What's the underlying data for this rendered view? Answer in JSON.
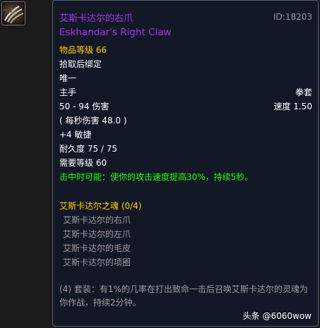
{
  "item": {
    "icon": "claw-icon",
    "id_label": "ID:18203",
    "name_cn": "艾斯卡达尔的右爪",
    "name_en": "Eskhandar's Right Claw",
    "item_level": "物品等级 66",
    "bind": "拾取后绑定",
    "unique": "唯一",
    "slot": "主手",
    "type": "拳套",
    "damage": "50 - 94 伤害",
    "speed": "速度 1.50",
    "dps": "( 每秒伤害 48.0 )",
    "stat": "+4 敏捷",
    "durability": "耐久度 75 / 75",
    "required_level": "需要等级 60",
    "chance_on_hit": "击中时可能：使你的攻击速度提高30%，持续5秒。"
  },
  "set": {
    "name": "艾斯卡达尔之魂 (0/4)",
    "pieces": [
      "艾斯卡达尔的右爪",
      "艾斯卡达尔的左爪",
      "艾斯卡达尔的毛皮",
      "艾斯卡达尔的项圈"
    ],
    "bonus": "(4) 套装：有1%的几率在打出致命一击后召唤艾斯卡达尔的灵魂为你作战，持续2分钟。"
  },
  "watermark": "头条 @6060wow",
  "colors": {
    "epic": "#a335ee",
    "gold": "#ffd100",
    "green": "#1eff00",
    "grey": "#9d9d9d",
    "tooltip_bg": "#131826"
  }
}
